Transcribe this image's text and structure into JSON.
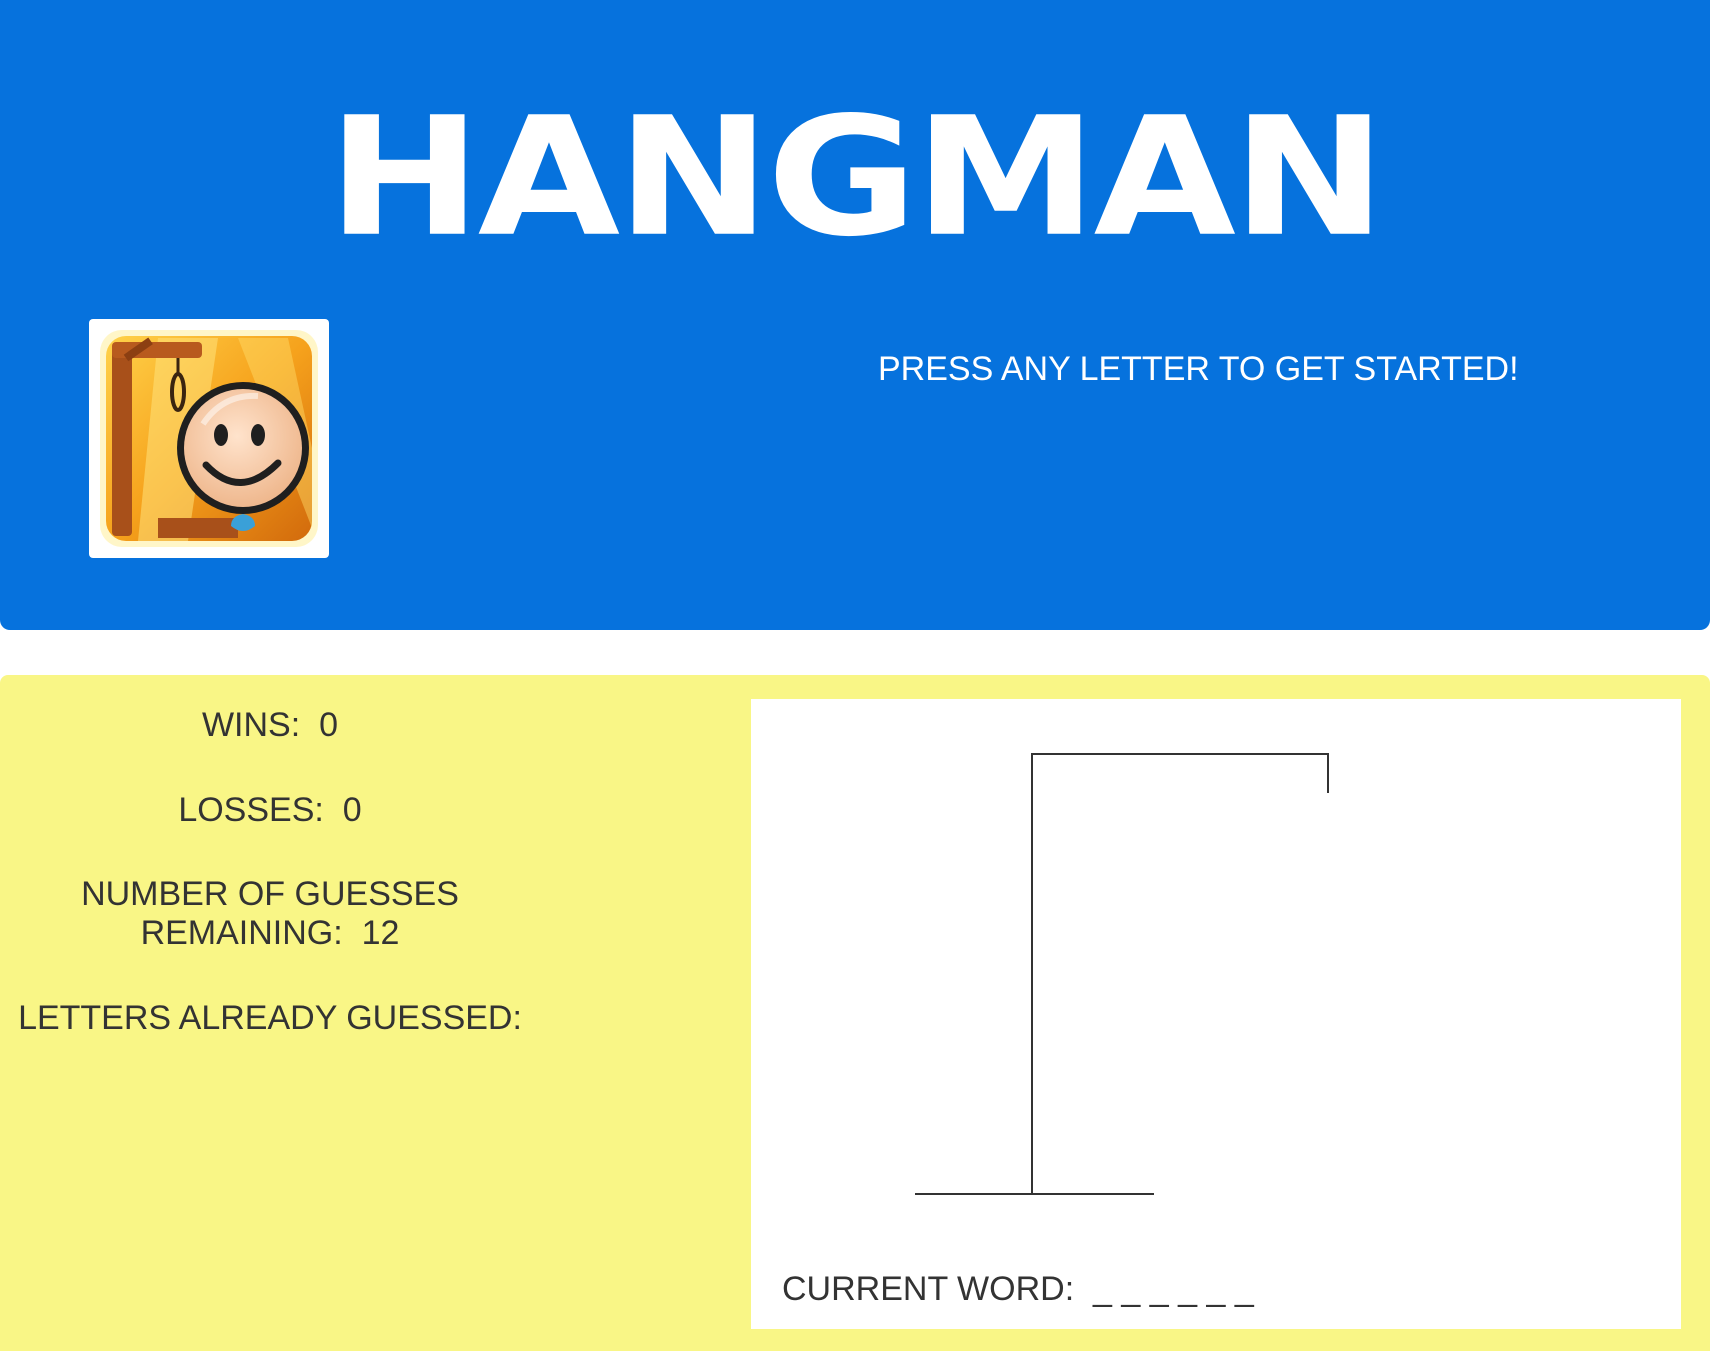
{
  "header": {
    "title": "HANGMAN",
    "prompt": "PRESS ANY LETTER TO GET STARTED!",
    "logo": "hangman-smiley-logo"
  },
  "stats": {
    "wins_label": "WINS:",
    "wins_value": "0",
    "losses_label": "LOSSES:",
    "losses_value": "0",
    "guesses_label_line1": "NUMBER OF GUESSES",
    "guesses_label_line2": "REMAINING:",
    "guesses_value": "12",
    "letters_label": "LETTERS ALREADY GUESSED:",
    "letters_value": ""
  },
  "board": {
    "current_word_label": "CURRENT WORD:",
    "current_word_value": "_ _ _ _ _ _"
  },
  "colors": {
    "header_bg": "#0672dd",
    "game_bg": "#f9f686",
    "board_bg": "#ffffff",
    "text": "#333333"
  }
}
